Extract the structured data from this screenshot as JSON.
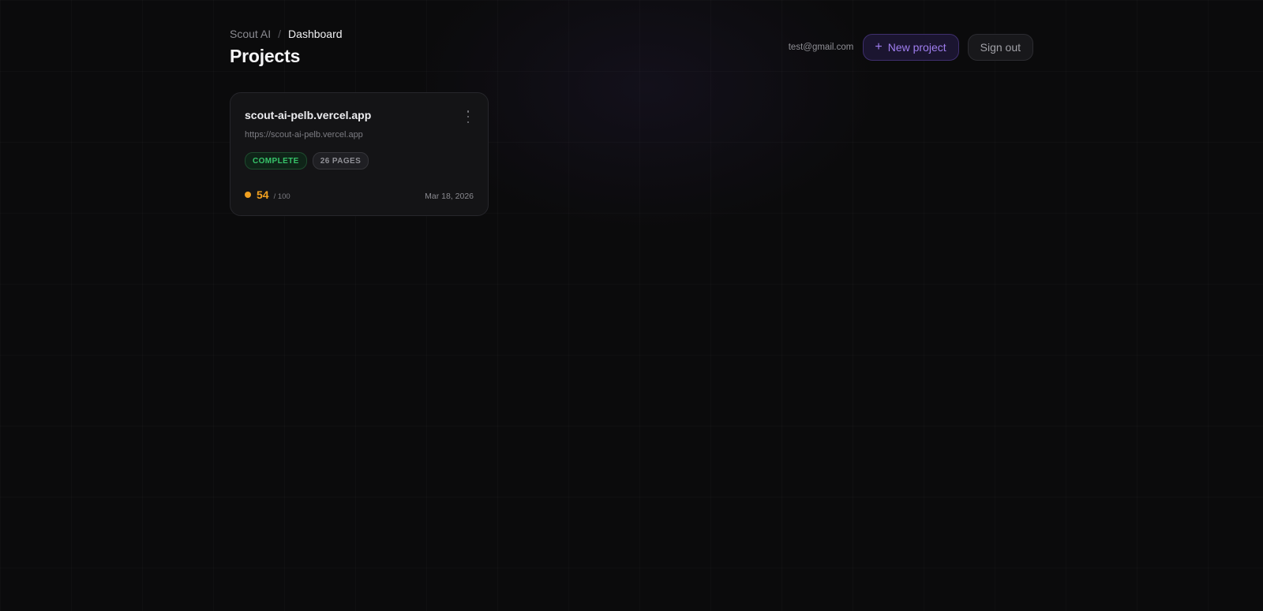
{
  "breadcrumb": {
    "root": "Scout AI",
    "separator": "/",
    "current": "Dashboard"
  },
  "page_title": "Projects",
  "header": {
    "user_email": "test@gmail.com",
    "new_project_label": "New project",
    "new_project_icon": "+",
    "sign_out_label": "Sign out"
  },
  "projects": [
    {
      "name": "scout-ai-pelb.vercel.app",
      "url": "https://scout-ai-pelb.vercel.app",
      "status": "COMPLETE",
      "pages": "26 PAGES",
      "score": "54",
      "score_max": "/ 100",
      "date": "Mar 18, 2026"
    }
  ],
  "colors": {
    "background": "#0b0b0c",
    "accent": "#a07ef0",
    "status_complete": "#37c46a",
    "score": "#f0a020"
  }
}
